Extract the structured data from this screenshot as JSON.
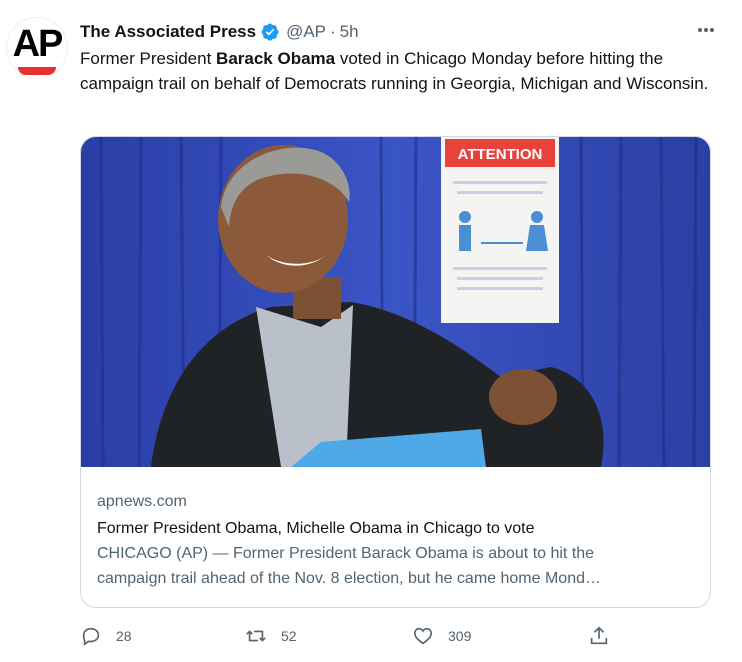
{
  "tweet": {
    "author_name": "The Associated Press",
    "avatar_text": "AP",
    "handle": "@AP",
    "separator": "·",
    "time": "5h",
    "text_prefix": "Former President ",
    "text_bold": "Barack Obama",
    "text_suffix": " voted in Chicago Monday before hitting the campaign trail on behalf of Democrats running in Georgia, Michigan and Wisconsin."
  },
  "card": {
    "domain": "apnews.com",
    "title": "Former President Obama, Michelle Obama in Chicago to vote",
    "description": "CHICAGO (AP) — Former President Barack Obama is about to hit the\ncampaign trail ahead of the Nov. 8 election, but he came home Mond…",
    "photo": {
      "sign_heading": "ATTENTION"
    }
  },
  "actions": {
    "reply_count": "28",
    "retweet_count": "52",
    "like_count": "309"
  },
  "colors": {
    "accent": "#1d9bf0",
    "muted": "#536471",
    "ap_red": "#e8312f"
  }
}
